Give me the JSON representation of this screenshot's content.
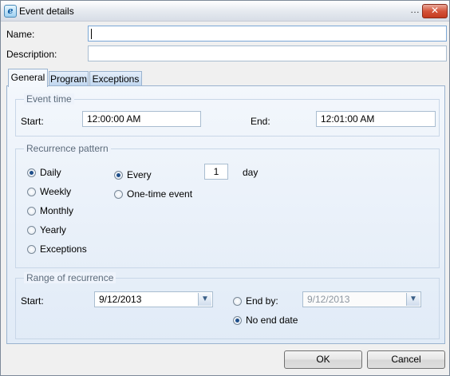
{
  "window": {
    "title": "Event details"
  },
  "form": {
    "name_label": "Name:",
    "name_value": "",
    "description_label": "Description:",
    "description_value": ""
  },
  "tabs": [
    {
      "label": "General",
      "active": true
    },
    {
      "label": "Program",
      "active": false
    },
    {
      "label": "Exceptions",
      "active": false
    }
  ],
  "event_time": {
    "legend": "Event time",
    "start_label": "Start:",
    "start_value": "12:00:00 AM",
    "end_label": "End:",
    "end_value": "12:01:00 AM"
  },
  "recurrence": {
    "legend": "Recurrence pattern",
    "options": [
      {
        "label": "Daily",
        "checked": true
      },
      {
        "label": "Weekly",
        "checked": false
      },
      {
        "label": "Monthly",
        "checked": false
      },
      {
        "label": "Yearly",
        "checked": false
      },
      {
        "label": "Exceptions",
        "checked": false
      }
    ],
    "every_label": "Every",
    "every_checked": true,
    "every_value": "1",
    "every_unit": "day",
    "onetime_label": "One-time event",
    "onetime_checked": false
  },
  "range": {
    "legend": "Range of recurrence",
    "start_label": "Start:",
    "start_value": "9/12/2013",
    "end_by_label": "End by:",
    "end_by_checked": false,
    "end_by_value": "9/12/2013",
    "no_end_label": "No end date",
    "no_end_checked": true
  },
  "buttons": {
    "ok": "OK",
    "cancel": "Cancel"
  },
  "icons": {
    "app": "ie-app-icon",
    "minimize": "minimize-icon",
    "close": "close-icon",
    "dropdown": "chevron-down-icon"
  }
}
